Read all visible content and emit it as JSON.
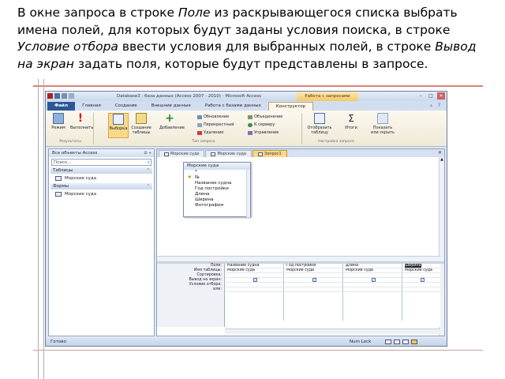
{
  "instruction": {
    "part1": "В окне запроса в строке ",
    "term_field": "Поле",
    "part2": " из раскрывающегося списка выбрать имена полей, для которых будут заданы условия поиска, в строке ",
    "term_condition": "Условие отбора",
    "part3": " ввести условия для выбранных полей, в строке ",
    "term_show": "Вывод на экран",
    "part4": " задать поля, которые будут представлены в запросе."
  },
  "window": {
    "title": "Database3 : база данных (Access 2007 - 2010) - Microsoft Access",
    "context_tab_title": "Работа с запросами"
  },
  "tabs": [
    "Файл",
    "Главная",
    "Создание",
    "Внешние данные",
    "Работа с базами данных",
    "Конструктор"
  ],
  "ribbon": {
    "buttons": {
      "view": "Режим",
      "run": "Выполнить",
      "select": "Выборка",
      "make_table": "Создание таблицы",
      "append": "Добавление",
      "show_table": "Отобразить таблицу",
      "totals": "Итоги",
      "property_sheet": "Показать или скрыть"
    },
    "small": {
      "update": "Обновление",
      "crosstab": "Перекрестный",
      "delete": "Удаление",
      "union": "Объединение",
      "passthrough": "К серверу",
      "data_def": "Управление"
    },
    "groups": {
      "results": "Результаты",
      "query_type": "Тип запроса",
      "setup": "Настройка запроса"
    }
  },
  "nav": {
    "header": "Все объекты Access",
    "search_placeholder": "Поиск...",
    "groups": [
      {
        "label": "Таблицы",
        "items": [
          "Морские суда"
        ]
      },
      {
        "label": "Формы",
        "items": [
          "Морские суда"
        ]
      }
    ]
  },
  "doc_tabs": [
    "Морские суда",
    "Морские суда",
    "Запрос1"
  ],
  "table_box": {
    "title": "Морские суда",
    "fields": [
      "*",
      "№",
      "Название судна",
      "Год постройки",
      "Длина",
      "Ширина",
      "Фотография"
    ]
  },
  "grid": {
    "row_labels": [
      "Поле:",
      "Имя таблицы:",
      "Сортировка:",
      "Вывод на экран:",
      "Условие отбора:",
      "или:"
    ],
    "columns": [
      {
        "field": "Название судна",
        "table": "Морские суда"
      },
      {
        "field": "Год постройки",
        "table": "Морские суда"
      },
      {
        "field": "Длина",
        "table": "Морские суда"
      },
      {
        "field": "Ширина",
        "table": "Морские суда"
      }
    ]
  },
  "status": {
    "ready": "Готово",
    "numlock": "Num Lock"
  },
  "colors": {
    "accent": "#2b5797",
    "context": "#f4c766",
    "deco": "#e08080"
  }
}
